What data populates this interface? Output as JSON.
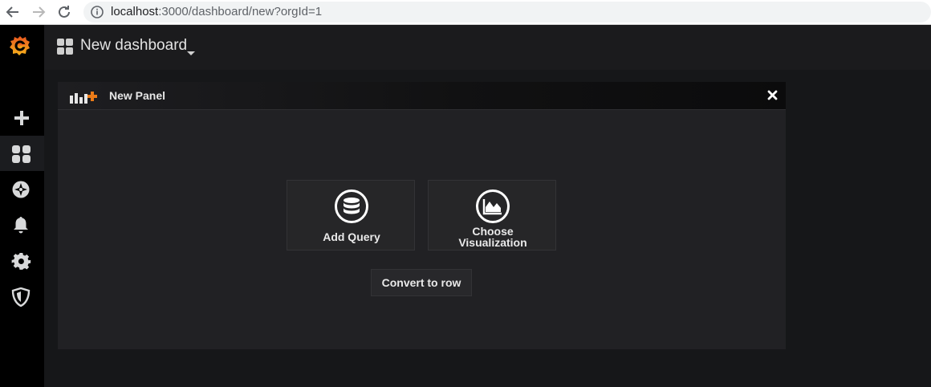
{
  "browser": {
    "url_host": "localhost",
    "url_rest": ":3000/dashboard/new?orgId=1"
  },
  "sidemenu": {
    "items": [
      {
        "icon": "grafana-logo-icon"
      },
      {
        "icon": "plus-icon"
      },
      {
        "icon": "dashboards-icon"
      },
      {
        "icon": "compass-icon"
      },
      {
        "icon": "bell-icon"
      },
      {
        "icon": "gear-icon"
      },
      {
        "icon": "shield-icon"
      }
    ],
    "active": "dashboards-icon"
  },
  "navbar": {
    "title": "New dashboard"
  },
  "panel": {
    "title": "New Panel",
    "actions": {
      "add_query": "Add Query",
      "choose_line1": "Choose",
      "choose_line2": "Visualization",
      "convert": "Convert to row"
    }
  },
  "colors": {
    "accent": "#eb7b18",
    "background": "#161719",
    "sidemenu": "#000000",
    "panel": "#212124"
  }
}
